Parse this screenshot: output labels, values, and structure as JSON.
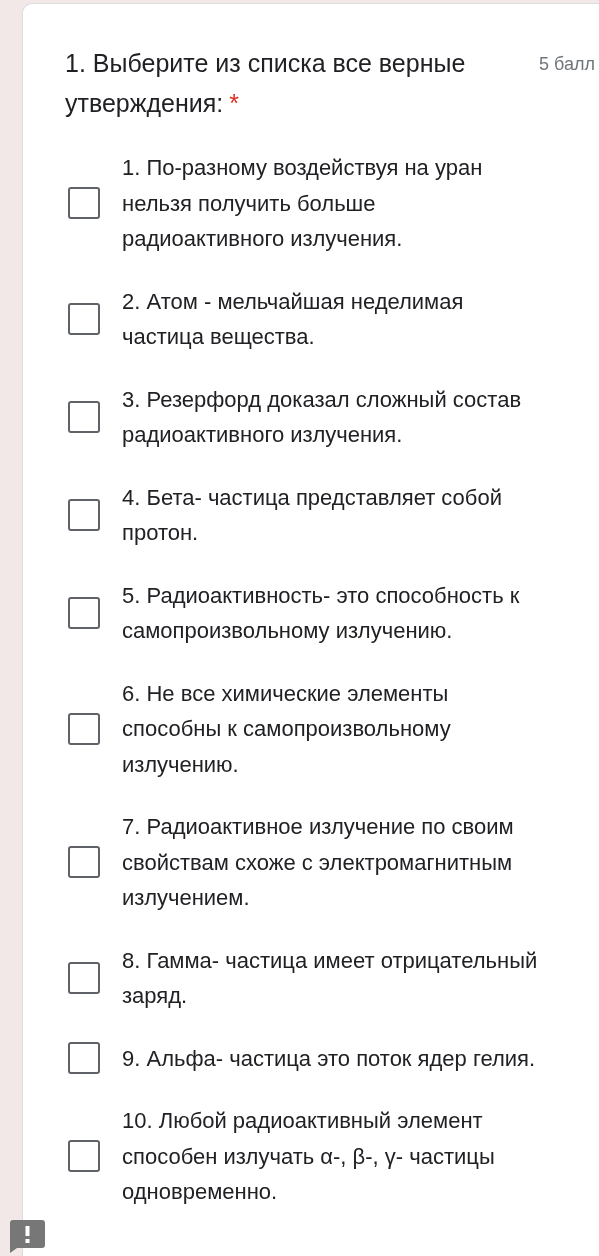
{
  "question": {
    "title": "1. Выберите из списка все верные утверждения:",
    "required_mark": "*",
    "points": "5 балл"
  },
  "options": [
    {
      "label": "1. По-разному воздействуя на уран нельзя получить больше радиоактивного излучения.",
      "checked": false
    },
    {
      "label": "2. Атом - мельчайшая неделимая частица вещества.",
      "checked": false
    },
    {
      "label": "3. Резерфорд доказал сложный состав радиоактивного излучения.",
      "checked": false
    },
    {
      "label": "4. Бета- частица представляет собой протон.",
      "checked": false
    },
    {
      "label": "5. Радиоактивность- это способность к самопроизвольному излучению.",
      "checked": false
    },
    {
      "label": "6. Не все химические элементы способны к самопроизвольному излучению.",
      "checked": false
    },
    {
      "label": "7. Радиоактивное излучение по своим свойствам схоже с электромагнитным излучением.",
      "checked": false
    },
    {
      "label": "8. Гамма- частица имеет отрицательный заряд.",
      "checked": false
    },
    {
      "label": "9. Альфа- частица это поток ядер гелия.",
      "checked": false
    },
    {
      "label": "10. Любой радиоактивный элемент способен излучать α-, β-, γ- частицы одновременно.",
      "checked": false
    }
  ]
}
